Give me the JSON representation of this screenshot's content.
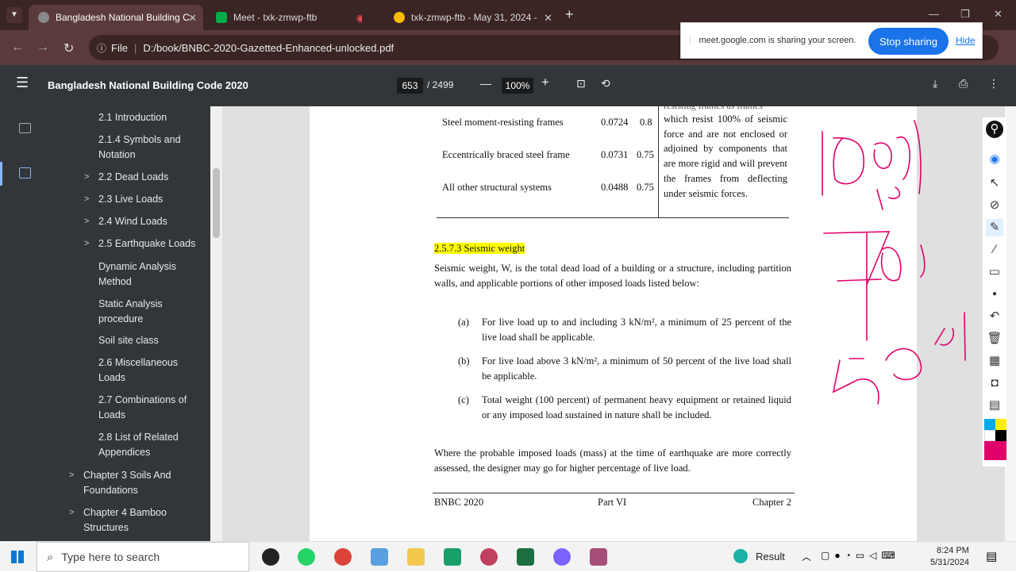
{
  "tabs": [
    {
      "title": "Bangladesh National Building C",
      "active": true,
      "color": "#f7a7a7"
    },
    {
      "title": "Meet - txk-zmwp-ftb",
      "active": false,
      "color": "#00ac47"
    },
    {
      "title": "txk-zmwp-ftb - May 31, 2024 -",
      "active": false,
      "color": "#fbbc04"
    }
  ],
  "address": {
    "scheme": "File",
    "path": "D:/book/BNBC-2020-Gazetted-Enhanced-unlocked.pdf"
  },
  "share_bar": {
    "message": "meet.google.com is sharing your screen.",
    "stop": "Stop sharing",
    "hide": "Hide"
  },
  "pdf": {
    "title": "Bangladesh National Building Code 2020",
    "page": "653",
    "total": "/ 2499",
    "zoom": "100%"
  },
  "outline": [
    {
      "label": "2.1 Introduction",
      "chevron": false,
      "indent": 2
    },
    {
      "label": "2.1.4 Symbols and Notation",
      "chevron": false,
      "indent": 2
    },
    {
      "label": "2.2 Dead Loads",
      "chevron": true,
      "indent": 2
    },
    {
      "label": "2.3 Live Loads",
      "chevron": true,
      "indent": 2
    },
    {
      "label": "2.4 Wind Loads",
      "chevron": true,
      "indent": 2
    },
    {
      "label": "2.5 Earthquake Loads",
      "chevron": true,
      "indent": 2
    },
    {
      "label": "Dynamic Analysis Method",
      "chevron": false,
      "indent": 2
    },
    {
      "label": "Static Analysis procedure",
      "chevron": false,
      "indent": 2
    },
    {
      "label": "Soil site class",
      "chevron": false,
      "indent": 2
    },
    {
      "label": "2.6 Miscellaneous Loads",
      "chevron": false,
      "indent": 2
    },
    {
      "label": "2.7 Combinations of Loads",
      "chevron": false,
      "indent": 2
    },
    {
      "label": "2.8 List of Related Appendices",
      "chevron": false,
      "indent": 2
    },
    {
      "label": "Chapter 3 Soils And Foundations",
      "chevron": true,
      "indent": 1
    },
    {
      "label": "Chapter 4 Bamboo Structures",
      "chevron": true,
      "indent": 1
    }
  ],
  "doc": {
    "rows": [
      {
        "system": "Steel moment-resisting frames",
        "ct": "0.0724",
        "m": "0.8"
      },
      {
        "system": "Eccentrically braced steel frame",
        "ct": "0.0731",
        "m": "0.75"
      },
      {
        "system": "All other structural systems",
        "ct": "0.0488",
        "m": "0.75"
      }
    ],
    "note_top": "resisting frames as frames",
    "note": "which resist 100% of seismic force and are not enclosed or adjoined by components that are more rigid and will prevent the frames from deflecting under seismic forces.",
    "heading": "2.5.7.3  Seismic weight",
    "para": "Seismic weight, W, is the total dead load of a building or a structure, including partition walls, and applicable portions of other imposed loads listed below:",
    "items": [
      {
        "tag": "(a)",
        "text": "For live load up to and including 3 kN/m², a minimum of 25 percent of the live load shall be applicable."
      },
      {
        "tag": "(b)",
        "text": "For live load above 3 kN/m², a minimum of 50 percent of the live load shall be applicable."
      },
      {
        "tag": "(c)",
        "text": "Total weight (100 percent) of permanent heavy equipment or retained liquid or any imposed load sustained in nature shall be included."
      }
    ],
    "closing": "Where the probable imposed loads (mass) at the time of earthquake are more correctly assessed, the designer may go for higher percentage of live load.",
    "footer": {
      "left": "BNBC 2020",
      "center": "Part VI",
      "right": "Chapter 2"
    }
  },
  "ink_color": "#e0006a",
  "taskbar": {
    "search": "Type here to search",
    "weather": "Result",
    "time": "8:24 PM",
    "date": "5/31/2024"
  }
}
